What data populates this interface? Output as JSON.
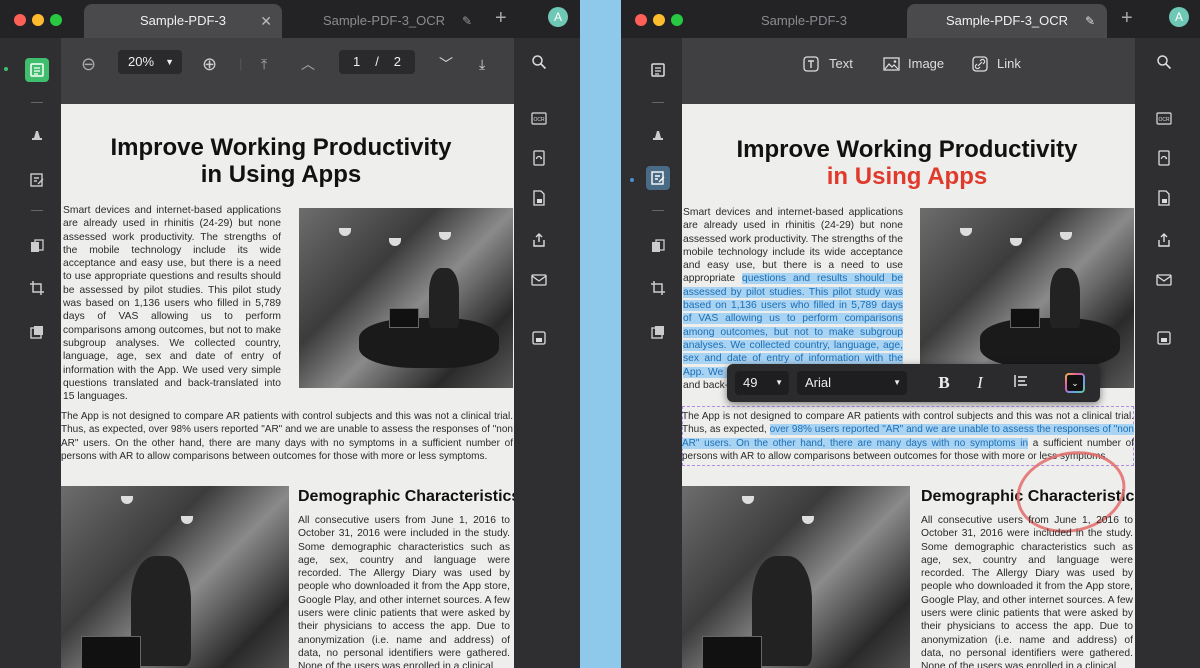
{
  "left": {
    "tabs": [
      {
        "label": "Sample-PDF-3",
        "active": true
      },
      {
        "label": "Sample-PDF-3_OCR",
        "active": false
      }
    ],
    "avatar": "A",
    "toolbar": {
      "zoom": "20%",
      "page_current": "1",
      "page_sep": "/",
      "page_total": "2"
    },
    "doc": {
      "title_line1": "Improve Working Productivity",
      "title_line2": "in Using Apps",
      "para1": "Smart devices and internet-based applications are already used in rhinitis (24-29) but none assessed work productivity. The strengths of the mobile technology include its wide acceptance and easy use, but there is a need to use appropriate questions and results should be assessed by pilot studies. This pilot study was based on 1,136 users who filled in 5,789 days of VAS allowing us to perform comparisons among outcomes, but not to make subgroup analyses. We collected country, language, age, sex and date of entry of information with the App. We used very simple questions translated and back-translated into 15 languages.",
      "para2": "The App is not designed to compare AR patients with control subjects and this was not a clinical trial. Thus, as expected, over 98% users reported \"AR\" and we are unable to assess the responses of \"non AR\" users. On the other hand, there are many days with no symptoms in a sufficient number of persons with AR to allow comparisons between outcomes for those with more or less symptoms.",
      "heading2": "Demographic Characteristics",
      "para3": "All consecutive users from June 1, 2016 to October 31, 2016 were included in the study. Some demographic characteristics such as age, sex, country and language were recorded. The Allergy Diary was used by people who downloaded it from the App store, Google Play, and other internet sources. A few users were clinic patients that were asked by their physicians to access the app. Due to anonymization (i.e. name and address) of data, no personal identifiers were gathered. None of the users was enrolled in a clinical"
    }
  },
  "right": {
    "tabs": [
      {
        "label": "Sample-PDF-3",
        "active": false
      },
      {
        "label": "Sample-PDF-3_OCR",
        "active": true
      }
    ],
    "avatar": "A",
    "toolbar": {
      "text": "Text",
      "image": "Image",
      "link": "Link"
    },
    "format_toolbar": {
      "font_size": "49",
      "font_family": "Arial",
      "bold": "B",
      "italic": "I"
    },
    "doc": {
      "title_line1": "Improve Working Productivity",
      "title_line2": "in Using Apps",
      "para1_plain": "Smart devices and internet-based applications are already used in rhinitis (24-29) but none assessed work productivity. The strengths of the mobile technology include its wide acceptance and easy use, but there is a need to use appropriate ",
      "para1_hl": "questions and results should be assessed by pilot studies. This pilot study was based on 1,136 users who filled in 5,789 days of VAS allowing us to perform comparisons among outcomes, but not to make subgroup analyses. We collected country, language, age, sex and date of entry of information with the App. We used ver",
      "para1_tail": "y simple questions translated and back-translated into 15 languages.",
      "para2_a": "The App is not designed to compare AR patients with control subjects and this was not a clinical trial. Thus, as expected, ",
      "para2_hl": "over 98% users reported \"AR\" and we are unable to assess the responses of \"non AR\" users. On the other hand, there are many days with no symptoms in",
      "para2_b": " a sufficient number of persons with AR to allow comparisons between outcomes for those with more or less symptoms.",
      "heading2": "Demographic Characteristics",
      "para3": "All consecutive users from June 1, 2016 to October 31, 2016 were included in the study. Some demographic characteristics such as age, sex, country and language were recorded. The Allergy Diary was used by people who downloaded it from the App store, Google Play, and other internet sources. A few users were clinic patients that were asked by their physicians to access the app. Due to anonymization (i.e. name and address) of data, no personal identifiers were gathered. None of the users was enrolled in a clinical"
    }
  },
  "colors": {
    "accent_green": "#3fbf6e",
    "title_red": "#e03a2d",
    "highlight": "#a9d3f3",
    "annotation_circle": "#e26b6b"
  }
}
